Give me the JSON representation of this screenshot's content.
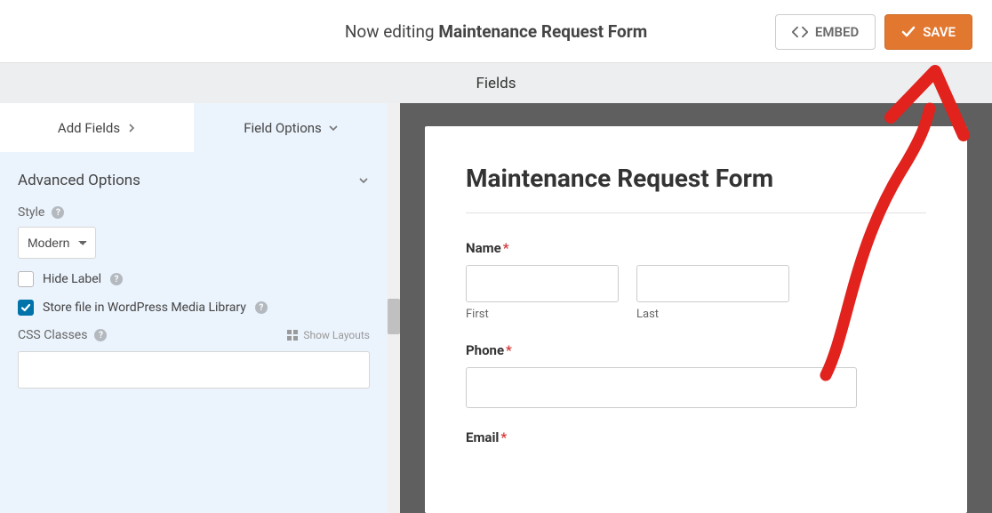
{
  "header": {
    "editing_prefix": "Now editing ",
    "form_name": "Maintenance Request Form",
    "embed_label": "EMBED",
    "save_label": "SAVE"
  },
  "panel_header": "Fields",
  "sidebar": {
    "tab_add": "Add Fields",
    "tab_options": "Field Options",
    "advanced_header": "Advanced Options",
    "style_label": "Style",
    "style_value": "Modern",
    "hide_label": "Hide Label",
    "store_media": "Store file in WordPress Media Library",
    "css_classes_label": "CSS Classes",
    "show_layouts": "Show Layouts",
    "css_classes_value": ""
  },
  "form": {
    "title": "Maintenance Request Form",
    "name_label": "Name",
    "first_sub": "First",
    "last_sub": "Last",
    "phone_label": "Phone",
    "email_label": "Email"
  },
  "colors": {
    "accent": "#e27730",
    "required": "#d63638"
  }
}
